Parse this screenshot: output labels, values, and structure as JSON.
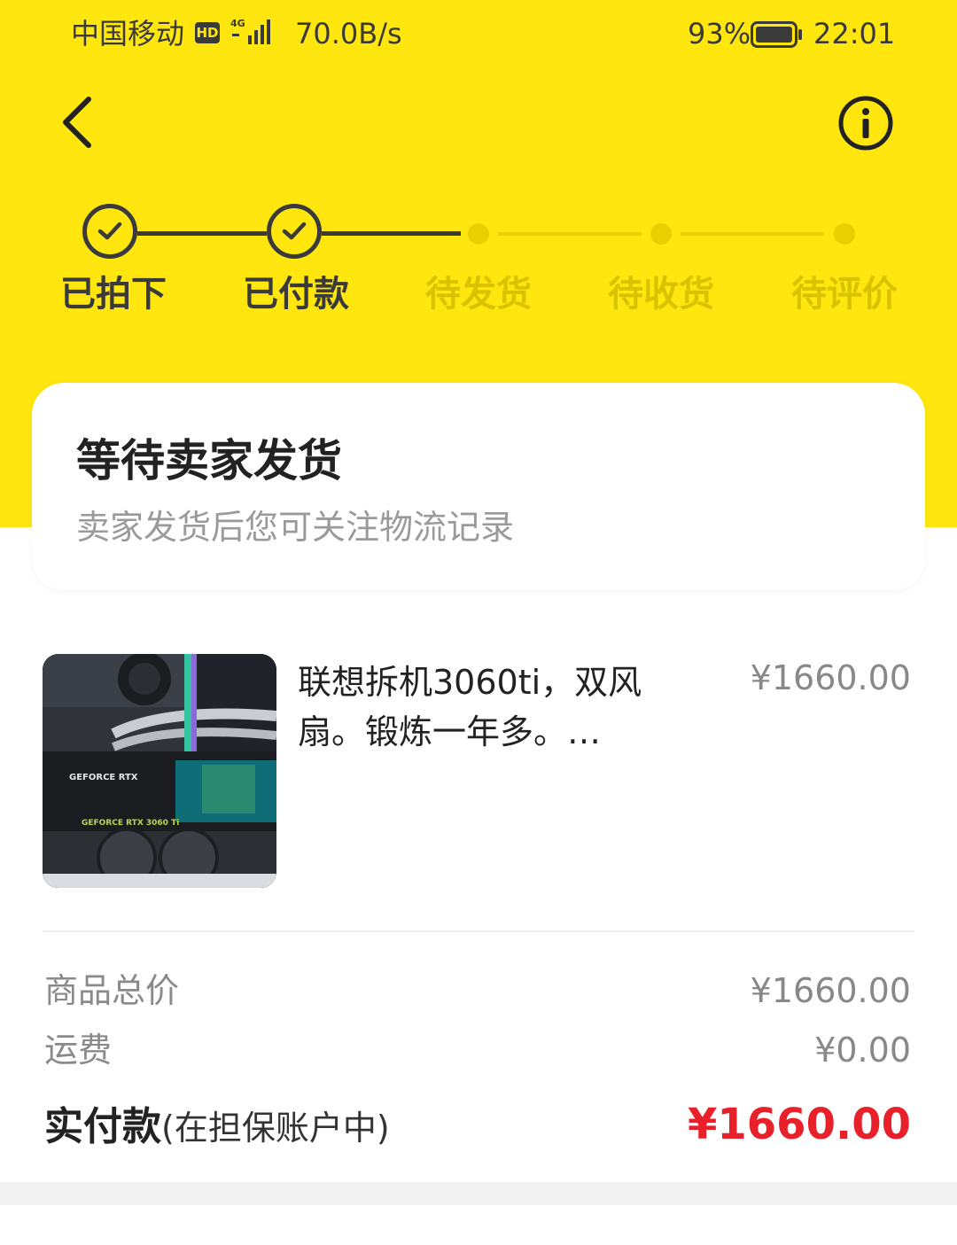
{
  "status_bar": {
    "carrier": "中国移动",
    "hd_badge": "HD",
    "network_type": "4G",
    "net_speed": "70.0B/s",
    "battery_percent": "93%",
    "battery_level": 0.93,
    "time": "22:01"
  },
  "nav": {
    "back_icon": "chevron-left-icon",
    "info_icon": "info-circle-icon"
  },
  "progress": {
    "steps": [
      {
        "label": "已拍下",
        "done": true
      },
      {
        "label": "已付款",
        "done": true
      },
      {
        "label": "待发货",
        "done": false
      },
      {
        "label": "待收货",
        "done": false
      },
      {
        "label": "待评价",
        "done": false
      }
    ]
  },
  "status_card": {
    "title": "等待卖家发货",
    "subtitle": "卖家发货后您可关注物流记录"
  },
  "product": {
    "title": "联想拆机3060ti，双风扇。锻炼一年多。…",
    "price": "¥1660.00",
    "image_text_1": "GEFORCE RTX",
    "image_text_2": "GEFORCE RTX 3060 Ti"
  },
  "summary": {
    "goods_total_label": "商品总价",
    "goods_total_value": "¥1660.00",
    "shipping_label": "运费",
    "shipping_value": "¥0.00",
    "paid_label": "实付款",
    "paid_note": "(在担保账户中)",
    "paid_value": "¥1660.00"
  },
  "colors": {
    "brand_yellow": "#ffe60f",
    "price_red": "#e8202a",
    "dark": "#3a3a3a"
  }
}
